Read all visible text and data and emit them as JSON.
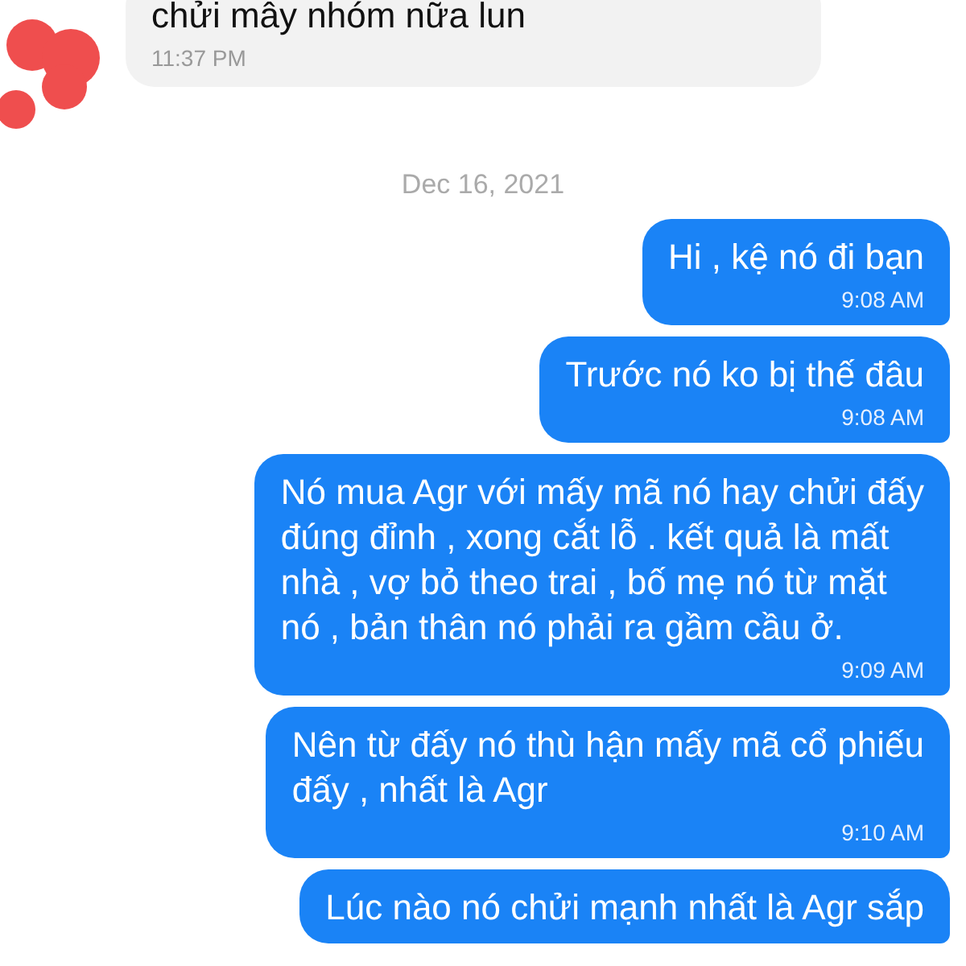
{
  "messages": [
    {
      "kind": "incoming",
      "lines": [
        "chửi mây nhóm nữa lun"
      ],
      "time": "11:37 PM"
    },
    {
      "kind": "date",
      "lines": [
        "Dec 16, 2021"
      ]
    },
    {
      "kind": "outgoing",
      "lines": [
        "Hi , kệ nó đi bạn"
      ],
      "time": "9:08 AM"
    },
    {
      "kind": "outgoing",
      "lines": [
        "Trước nó ko bị thế đâu"
      ],
      "time": "9:08 AM"
    },
    {
      "kind": "outgoing",
      "lines": [
        "Nó mua Agr với mấy mã nó hay chửi đấy",
        "đúng đỉnh , xong cắt lỗ . kết quả là mất",
        "nhà , vợ bỏ theo trai , bố mẹ nó từ mặt",
        "nó , bản thân nó phải ra gầm cầu ở."
      ],
      "time": "9:09 AM"
    },
    {
      "kind": "outgoing",
      "lines": [
        "Nên từ đấy nó thù hận mấy mã cổ phiếu",
        "đấy , nhất là Agr"
      ],
      "time": "9:10 AM"
    },
    {
      "kind": "outgoing",
      "lines": [
        "Lúc nào nó chửi mạnh nhất là Agr sắp"
      ]
    }
  ]
}
